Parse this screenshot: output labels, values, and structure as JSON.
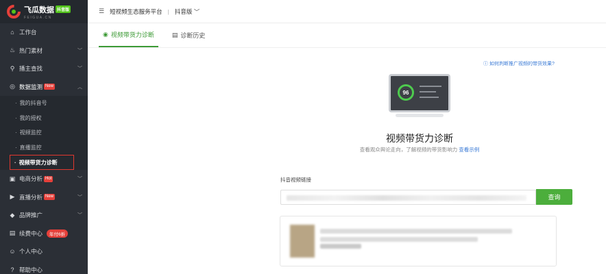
{
  "brand": {
    "title": "飞瓜数据",
    "badge": "抖音版",
    "subtitle": "FEIGUA.CN"
  },
  "sidebar": {
    "items": [
      {
        "label": "工作台",
        "icon": "home-icon",
        "glyph": "⌂",
        "chevron": false
      },
      {
        "label": "热门素材",
        "icon": "flame-icon",
        "glyph": "♨",
        "chevron": true
      },
      {
        "label": "播主查找",
        "icon": "search-icon",
        "glyph": "⚲",
        "chevron": true
      },
      {
        "label": "数据监测",
        "icon": "monitor-icon",
        "glyph": "◎",
        "badge": "New",
        "chevron": true,
        "expanded": true
      }
    ],
    "submenu": [
      {
        "label": "我的抖音号"
      },
      {
        "label": "我的授权"
      },
      {
        "label": "视频监控"
      },
      {
        "label": "直播监控"
      },
      {
        "label": "视频带货力诊断",
        "selected": true
      }
    ],
    "items_after": [
      {
        "label": "电商分析",
        "icon": "cart-icon",
        "glyph": "▣",
        "badge": "Hot",
        "chevron": true
      },
      {
        "label": "直播分析",
        "icon": "live-icon",
        "glyph": "▶",
        "badge": "New",
        "chevron": true
      },
      {
        "label": "品牌推广",
        "icon": "diamond-icon",
        "glyph": "◆",
        "chevron": true
      },
      {
        "label": "续费中心",
        "icon": "card-icon",
        "glyph": "▤",
        "pill": "年付6折"
      },
      {
        "label": "个人中心",
        "icon": "user-icon",
        "glyph": "☺"
      },
      {
        "label": "帮助中心",
        "icon": "help-icon",
        "glyph": "?"
      }
    ]
  },
  "topbar": {
    "platform": "短视频生态服务平台",
    "version": "抖音版"
  },
  "tabs": [
    {
      "label": "视频带货力诊断",
      "active": true
    },
    {
      "label": "诊断历史",
      "active": false
    }
  ],
  "main": {
    "help_link": "如何判断推广视频的带货效果?",
    "illustration_score": "96",
    "title": "视频带货力诊断",
    "subtitle_prefix": "查看观众舆论走向，了解视频的带货影响力",
    "subtitle_link": "查看示例",
    "input_label": "抖音视频链接",
    "query_button": "查询"
  },
  "colors": {
    "accent": "#4cae3c",
    "sidebar_bg": "#2b2f36",
    "highlight_border": "#e2382f",
    "link": "#3b7bd6"
  }
}
